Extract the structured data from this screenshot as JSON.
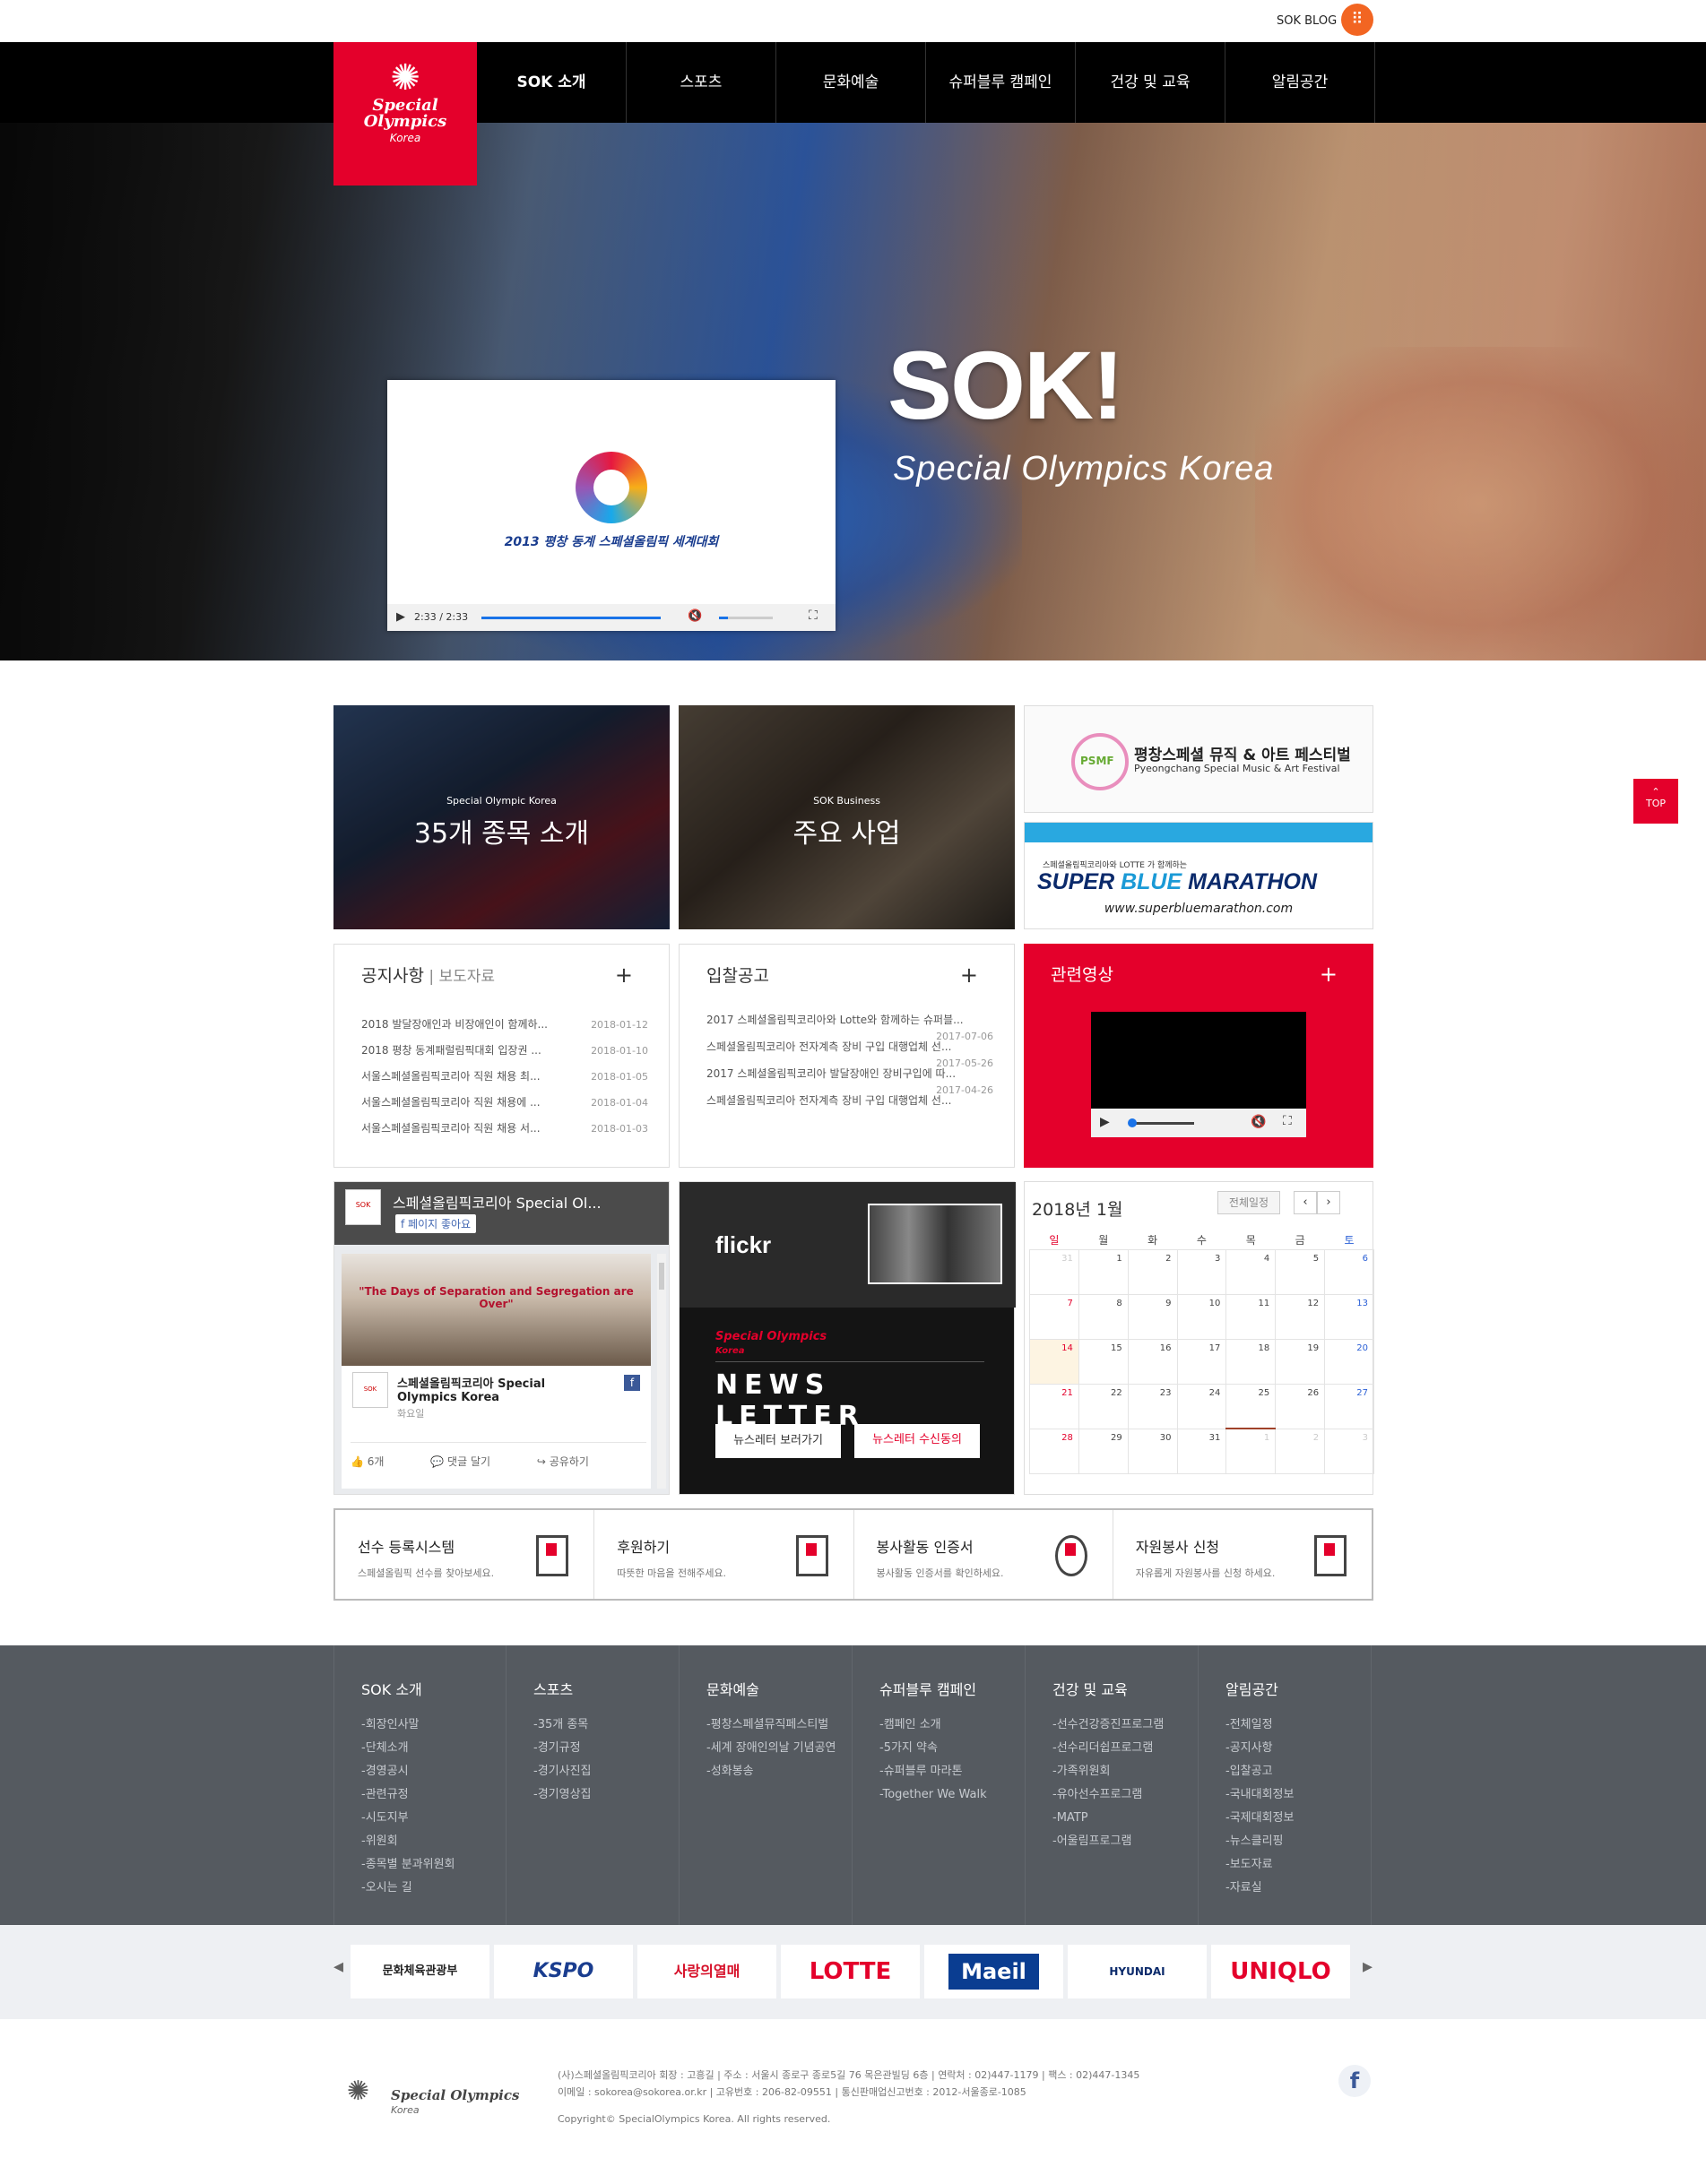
{
  "topbar": {
    "blog_label": "SOK BLOG",
    "blog_icon": "dots-icon"
  },
  "logo": {
    "line1": "Special",
    "line2": "Olympics",
    "line3": "Korea"
  },
  "nav": [
    "SOK 소개",
    "스포츠",
    "문화예술",
    "슈퍼블루 캠페인",
    "건강 및 교육",
    "알림공간"
  ],
  "hero": {
    "title": "SOK!",
    "subtitle": "Special Olympics Korea",
    "video": {
      "caption": "2013 평창 동계 스페셜올림픽 세계대회",
      "time": "2:33 / 2:33"
    }
  },
  "top_button": "TOP",
  "tiles": {
    "sports": {
      "small": "Special Olympic Korea",
      "big": "35개 종목 소개"
    },
    "business": {
      "small": "SOK Business",
      "big": "주요 사업"
    }
  },
  "banners": {
    "festival": {
      "title": "평창스페셜 뮤직 & 아트 페스티벌",
      "subtitle": "Pyeongchang Special Music & Art Festival"
    },
    "marathon": {
      "top": "스페셜올림픽코리아와 LOTTE 가 함께하는",
      "title_a": "SUPER ",
      "title_b": "BLUE",
      "title_c": " MARATHON",
      "url": "www.superbluemarathon.com"
    }
  },
  "notice": {
    "title": "공지사항",
    "sep": " | ",
    "alt": "보도자료",
    "items": [
      {
        "text": "2018 발달장애인과 비장애인이 함께하...",
        "date": "2018-01-12"
      },
      {
        "text": "2018 평창 동계패럴림픽대회 입장권 ...",
        "date": "2018-01-10"
      },
      {
        "text": "서울스페셜올림픽코리아 직원 채용 최...",
        "date": "2018-01-05"
      },
      {
        "text": "서울스페셜올림픽코리아 직원 채용에 ...",
        "date": "2018-01-04"
      },
      {
        "text": "서울스페셜올림픽코리아 직원 채용 서...",
        "date": "2018-01-03"
      }
    ]
  },
  "bid": {
    "title": "입찰공고",
    "items": [
      {
        "text": "2017 스페셜올림픽코리아와 Lotte와 함께하는 슈퍼블...",
        "date": "2017-07-06"
      },
      {
        "text": "스페셜올림픽코리아 전자계측 장비 구입 대행업체 선...",
        "date": "2017-05-26"
      },
      {
        "text": "2017 스페셜올림픽코리아 발달장애인 장비구입에 따...",
        "date": "2017-04-26"
      },
      {
        "text": "스페셜올림픽코리아 전자계측 장비 구입 대행업체 선...",
        "date": ""
      }
    ]
  },
  "movies": {
    "title": "관련영상"
  },
  "facebook": {
    "page_name": "스페셜올림픽코리아 Special Ol...",
    "like_label": "페이지 좋아요",
    "post_image_text": "\"The Days of Separation and Segregation are Over\"",
    "post_name": "스페셜올림픽코리아 Special Olympics Korea",
    "post_time": "화요일",
    "likes": "6개",
    "comment": "댓글 달기",
    "share": "공유하기"
  },
  "flickr": {
    "logo": "flickr",
    "brand": "Special Olympics",
    "brand_sub": "Korea",
    "newsletter": "NEWS LETTER",
    "view_button": "뉴스레터 보러가기",
    "subscribe_button": "뉴스레터 수신동의"
  },
  "calendar": {
    "title": "2018년 1월",
    "all_button": "전체일정",
    "weekdays": [
      "일",
      "월",
      "화",
      "수",
      "목",
      "금",
      "토"
    ],
    "weeks": [
      [
        "31",
        "1",
        "2",
        "3",
        "4",
        "5",
        "6"
      ],
      [
        "7",
        "8",
        "9",
        "10",
        "11",
        "12",
        "13"
      ],
      [
        "14",
        "15",
        "16",
        "17",
        "18",
        "19",
        "20"
      ],
      [
        "21",
        "22",
        "23",
        "24",
        "25",
        "26",
        "27"
      ],
      [
        "28",
        "29",
        "30",
        "31",
        "1",
        "2",
        "3"
      ]
    ]
  },
  "quick": [
    {
      "title": "선수 등록시스템",
      "desc": "스페셜올림픽 선수를 찾아보세요.",
      "icon": "bookmark-doc-icon"
    },
    {
      "title": "후원하기",
      "desc": "따뜻한 마음을 전해주세요.",
      "icon": "document-icon"
    },
    {
      "title": "봉사활동 인증서",
      "desc": "봉사활동 인증서를 확인하세요.",
      "icon": "coins-icon"
    },
    {
      "title": "자원봉사 신청",
      "desc": "자유롭게 자원봉사를 신청 하세요.",
      "icon": "search-doc-icon"
    }
  ],
  "footer_menu": [
    {
      "title": "SOK 소개",
      "items": [
        "-회장인사말",
        "-단체소개",
        "-경영공시",
        "-관련규정",
        "-시도지부",
        "-위원회",
        "-종목별 분과위원회",
        "-오시는 길"
      ]
    },
    {
      "title": "스포츠",
      "items": [
        "-35개 종목",
        "-경기규정",
        "-경기사진집",
        "-경기영상집"
      ]
    },
    {
      "title": "문화예술",
      "items": [
        "-평창스페셜뮤직페스티벌",
        "-세계 장애인의날 기념공연",
        "-성화봉송"
      ]
    },
    {
      "title": "슈퍼블루 캠페인",
      "items": [
        "-캠페인 소개",
        "-5가지 약속",
        "-슈퍼블루 마라톤",
        "-Together We Walk"
      ]
    },
    {
      "title": "건강 및 교육",
      "items": [
        "-선수건강증진프로그램",
        "-선수리더쉽프로그램",
        "-가족위원회",
        "-유아선수프로그램",
        "-MATP",
        "-어울림프로그램"
      ]
    },
    {
      "title": "알림공간",
      "items": [
        "-전체일정",
        "-공지사항",
        "-입찰공고",
        "-국내대회정보",
        "-국제대회정보",
        "-뉴스클리핑",
        "-보도자료",
        "-자료실"
      ]
    }
  ],
  "partners": [
    "문화체육관광부",
    "KSPO",
    "사랑의열매",
    "LOTTE",
    "Maeil",
    "HYUNDAI",
    "UNIQLO"
  ],
  "footer": {
    "logo_name": "Special Olympics",
    "logo_sub": "Korea",
    "line1": "(사)스페셜올림픽코리아 회장 : 고흥길 | 주소 : 서울시 종로구 종로5길 76 목은관빌딩 6층 | 연락처 : 02)447-1179 | 팩스 : 02)447-1345",
    "line2": "이메일 : sokorea@sokorea.or.kr | 고유번호 : 206-82-09551 | 통신판매업신고번호 : 2012-서울종로-1085",
    "copyright": "Copyright© SpecialOlympics Korea. All rights reserved."
  }
}
